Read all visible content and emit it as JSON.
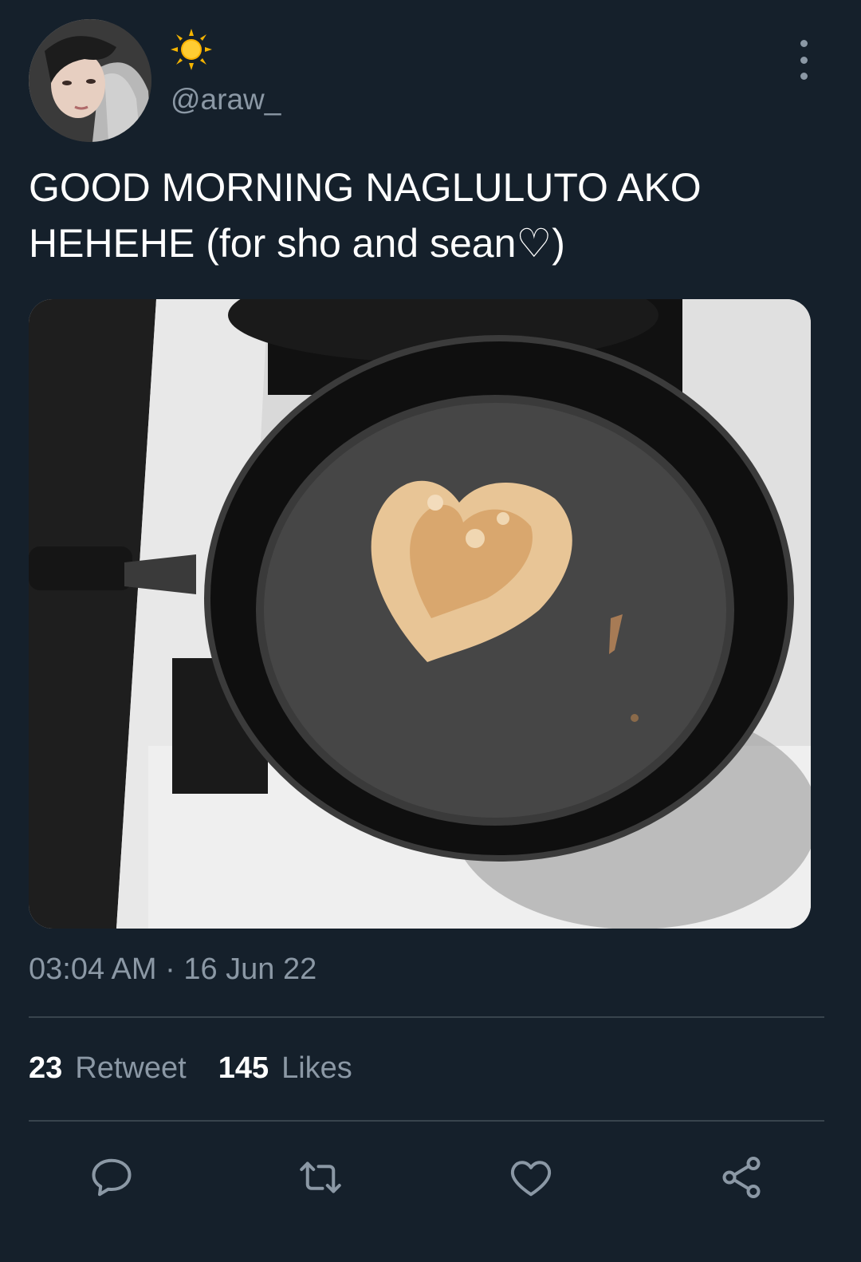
{
  "tweet": {
    "display_name_icon": "sun-emoji",
    "handle": "@araw_",
    "text": "GOOD MORNING NAGLULUTO AKO\nHEHEHE (for sho and sean♡)",
    "timestamp": "03:04 AM · 16 Jun 22"
  },
  "stats": {
    "retweets_count": "23",
    "retweets_label": "Retweet",
    "likes_count": "145",
    "likes_label": "Likes"
  },
  "actions": {
    "reply_icon": "reply-icon",
    "retweet_icon": "retweet-icon",
    "like_icon": "heart-icon",
    "share_icon": "share-icon"
  },
  "colors": {
    "background": "#15202b",
    "secondary_text": "#8b98a5",
    "divider": "#38444d"
  }
}
